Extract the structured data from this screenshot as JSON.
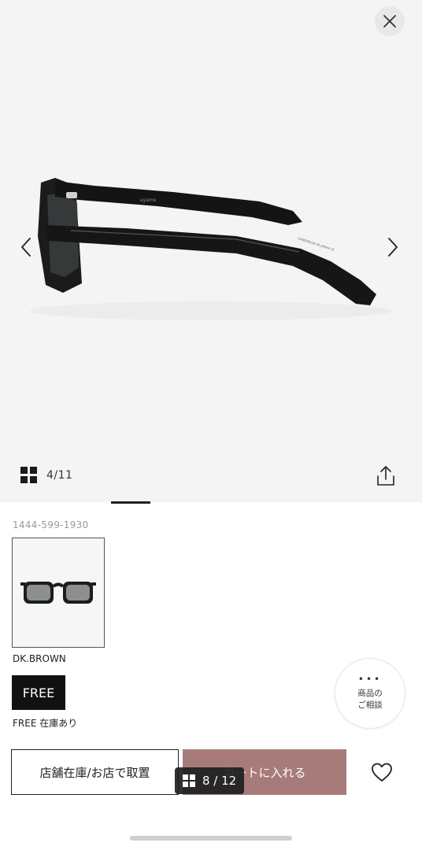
{
  "gallery": {
    "counter": "4/11",
    "brand_mark": "ayame",
    "temple_print": "HANDMADE IN JAPAN  CE"
  },
  "icons": {
    "close": "close-icon",
    "prev": "chevron-left-icon",
    "next": "chevron-right-icon",
    "grid": "grid-icon",
    "share": "share-icon",
    "favorite": "heart-icon"
  },
  "product": {
    "code": "1444-599-1930",
    "color_name": "DK.BROWN",
    "size_label": "FREE",
    "stock_status": "FREE 在庫あり"
  },
  "consult": {
    "line1": "商品の",
    "line2": "ご相談"
  },
  "actions": {
    "store_label": "店舗在庫/お店で取置",
    "cart_label": "カートに入れる"
  },
  "page_indicator": {
    "label": "8 / 12"
  },
  "colors": {
    "cart_button": "#a87b7b",
    "size_selected": "#111111",
    "gallery_background": "#f4f4f4"
  }
}
